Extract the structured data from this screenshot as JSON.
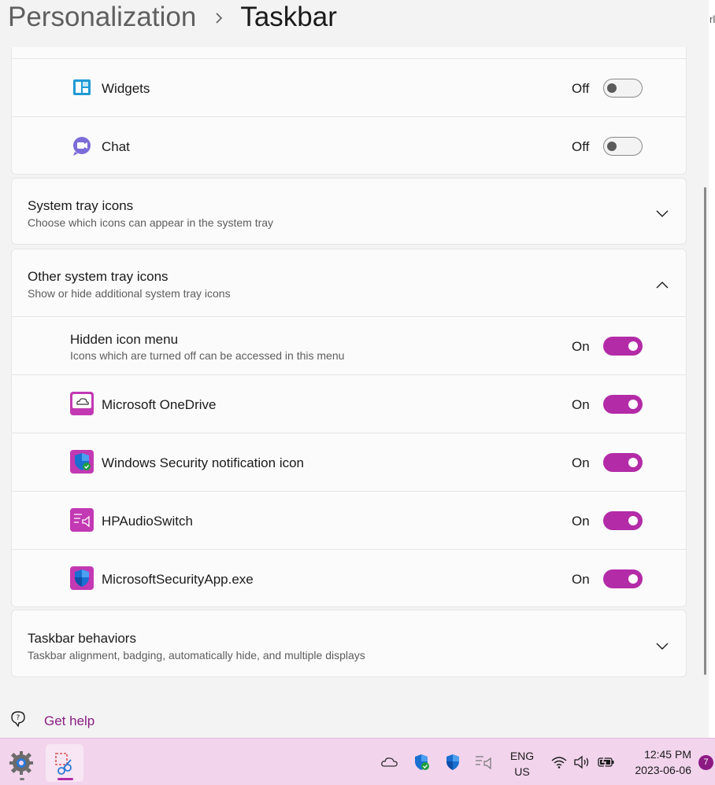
{
  "header": {
    "breadcrumb_parent": "Personalization",
    "breadcrumb_separator": ">",
    "breadcrumb_current": "Taskbar"
  },
  "right_pane": {
    "text_fragment": "rl"
  },
  "taskbar_items_card": {
    "rows": [
      {
        "label": "Widgets",
        "state": "Off",
        "toggle_on": false,
        "icon": "widgets-icon"
      },
      {
        "label": "Chat",
        "state": "Off",
        "toggle_on": false,
        "icon": "chat-icon"
      }
    ]
  },
  "system_tray_icons": {
    "title": "System tray icons",
    "description": "Choose which icons can appear in the system tray",
    "expanded": false
  },
  "other_system_tray_icons": {
    "title": "Other system tray icons",
    "description": "Show or hide additional system tray icons",
    "expanded": true,
    "rows": [
      {
        "label": "Hidden icon menu",
        "description": "Icons which are turned off can be accessed in this menu",
        "state": "On",
        "toggle_on": true
      },
      {
        "label": "Microsoft OneDrive",
        "state": "On",
        "toggle_on": true,
        "icon": "onedrive-icon"
      },
      {
        "label": "Windows Security notification icon",
        "state": "On",
        "toggle_on": true,
        "icon": "windows-security-icon"
      },
      {
        "label": "HPAudioSwitch",
        "state": "On",
        "toggle_on": true,
        "icon": "hp-audio-switch-icon"
      },
      {
        "label": "MicrosoftSecurityApp.exe",
        "state": "On",
        "toggle_on": true,
        "icon": "microsoft-security-app-icon"
      }
    ]
  },
  "taskbar_behaviors": {
    "title": "Taskbar behaviors",
    "description": "Taskbar alignment, badging, automatically hide, and multiple displays",
    "expanded": false
  },
  "help": {
    "label": "Get help"
  },
  "system_taskbar": {
    "apps": [
      "settings-icon",
      "snipping-tool-icon"
    ],
    "tray_icons": [
      "onedrive-tray-icon",
      "security-tray-icon",
      "defender-tray-icon",
      "audio-switch-tray-icon",
      "wifi-icon",
      "volume-icon",
      "battery-icon"
    ],
    "language_line1": "ENG",
    "language_line2": "US",
    "time": "12:45 PM",
    "date": "2023-06-06",
    "notification_count": "7"
  },
  "colors": {
    "accent": "#b32ba7",
    "link": "#8a1f83",
    "taskbar_bg": "#f2d4ec",
    "card_bg": "#fbfbfb"
  }
}
